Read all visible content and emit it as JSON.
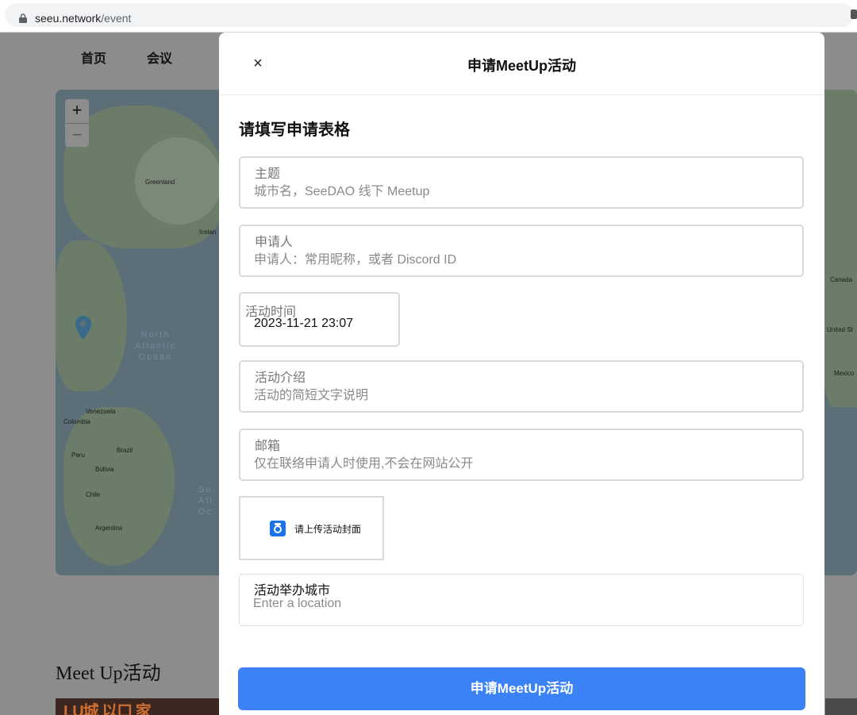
{
  "browser": {
    "url_host": "seeu.network",
    "url_path": "/event"
  },
  "background_page": {
    "nav": [
      "首页",
      "会议"
    ],
    "map": {
      "zoom_in": "+",
      "zoom_out": "−",
      "labels": [
        "Greenland",
        "Icelan",
        "Canada",
        "United St",
        "Mexico",
        "Venezuela",
        "Colombia",
        "Peru",
        "Brazil",
        "Bolivia",
        "Chile",
        "Argentina"
      ],
      "ocean_north": "North\nAtlantic\nOcean",
      "ocean_south": "So\nAtl\nOc"
    },
    "section_title": "Meet Up活动",
    "thumbnail_text": "LU城 以口 家"
  },
  "modal": {
    "close_symbol": "×",
    "title": "申请MeetUp活动",
    "form_heading": "请填写申请表格",
    "fields": [
      {
        "label": "主题",
        "placeholder": "城市名，SeeDAO 线下 Meetup"
      },
      {
        "label": "申请人",
        "placeholder": "申请人：常用昵称，或者 Discord ID"
      },
      {
        "label": "活动时间",
        "value": "2023-11-21 23:07"
      },
      {
        "label": "活动介绍",
        "placeholder": "活动的简短文字说明"
      },
      {
        "label": "邮箱",
        "placeholder": "仅在联络申请人时使用,不会在网站公开"
      },
      {
        "label": "活动举办城市",
        "placeholder": "Enter a location"
      }
    ],
    "upload_label": "请上传活动封面",
    "submit_label": "申请MeetUp活动"
  },
  "colors": {
    "primary_button": "#3b82f6",
    "camera_icon": "#1a73e8"
  }
}
